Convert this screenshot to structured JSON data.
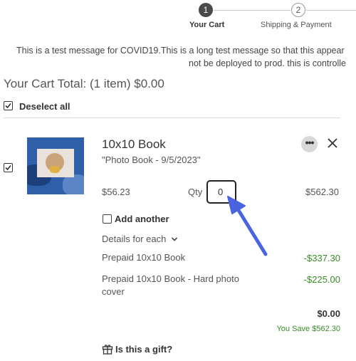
{
  "stepper": {
    "steps": [
      {
        "number": "1",
        "label": "Your Cart"
      },
      {
        "number": "2",
        "label": "Shipping & Payment"
      }
    ]
  },
  "banner": {
    "line1": "This is a test message for COVID19.This is a long test message so that this appear",
    "line2": "not be deployed to prod. this is controlle"
  },
  "cart": {
    "total_text": "Your Cart Total: (1 item) $0.00",
    "deselect_all": "Deselect all"
  },
  "item": {
    "title": "10x10 Book",
    "subtitle": "\"Photo Book - 9/5/2023\"",
    "more_label": "•••",
    "unit_price": "$56.23",
    "qty_label": "Qty",
    "qty_value": "0",
    "line_total": "$562.30",
    "add_another": "Add another",
    "details_for_each": "Details for each",
    "discounts": [
      {
        "label": "Prepaid 10x10 Book",
        "amount": "-$337.30"
      },
      {
        "label": "Prepaid 10x10 Book - Hard photo cover",
        "amount": "-$225.00"
      }
    ],
    "total": "$0.00",
    "you_save": "You Save $562.30",
    "gift_question": "Is this a gift?"
  },
  "colors": {
    "accent_green": "#3a8a2a",
    "annotation_arrow": "#4a63e0"
  }
}
